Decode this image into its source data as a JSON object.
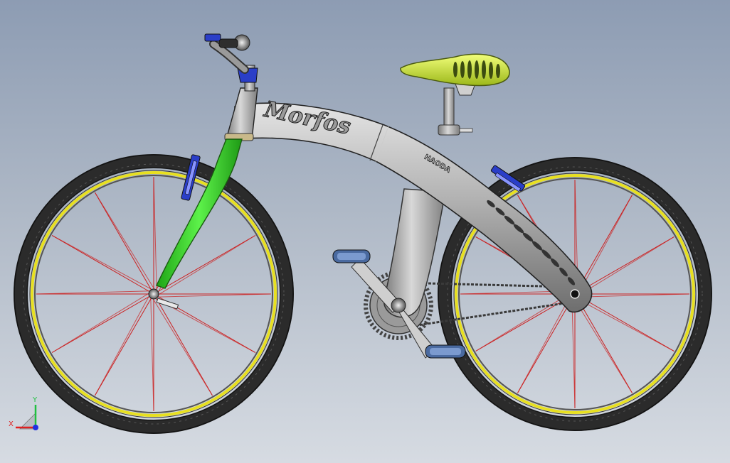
{
  "model": {
    "frame_text": "Morfos",
    "logo_text": "HAODA",
    "colors": {
      "background_top": "#8d9cb3",
      "background_bottom": "#d6dbe2",
      "frame": "#a9a9a9",
      "fork": "#3fd92e",
      "saddle": "#c8e23a",
      "rim": "#e8e020",
      "spokes": "#cc1f1f",
      "hardware": "#2a3ec8",
      "tire": "#2b2b2b"
    }
  },
  "triad": {
    "x_label": "X",
    "y_label": "Y",
    "x_color": "#e02020",
    "y_color": "#20c040",
    "z_color": "#2030e0"
  }
}
